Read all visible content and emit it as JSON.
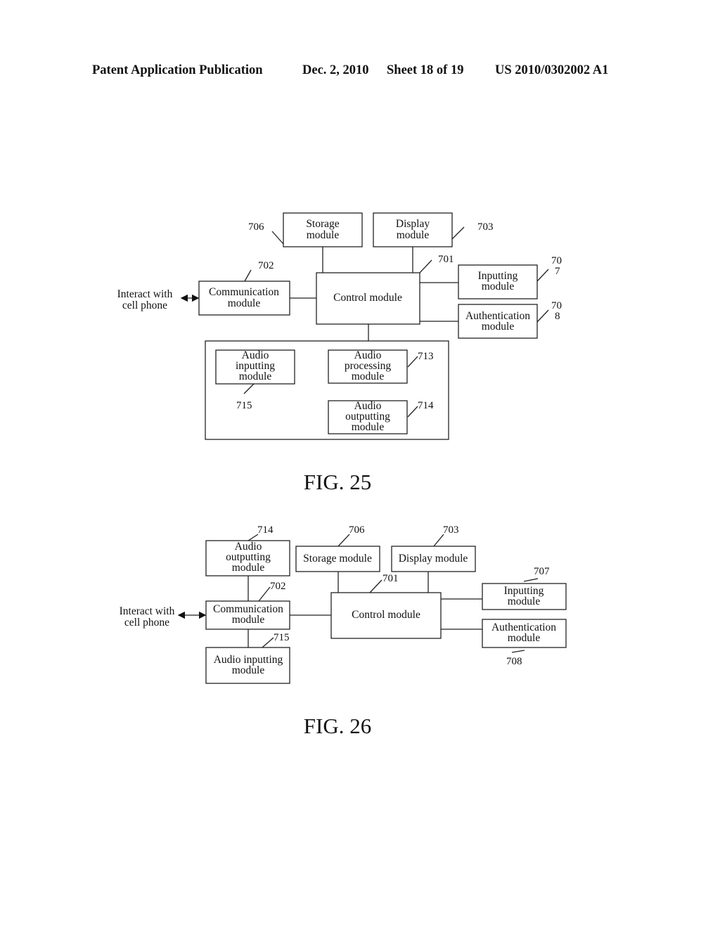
{
  "header": {
    "publication": "Patent Application Publication",
    "date": "Dec. 2, 2010",
    "sheet": "Sheet 18 of 19",
    "number": "US 2010/0302002 A1"
  },
  "fig25": {
    "caption": "FIG. 25",
    "external": [
      "Interact with",
      "cell phone"
    ],
    "storage": [
      "Storage",
      "module"
    ],
    "display": [
      "Display",
      "module"
    ],
    "communication": [
      "Communication",
      "module"
    ],
    "control": [
      "Control module"
    ],
    "inputting": [
      "Inputting",
      "module"
    ],
    "authentication": [
      "Authentication",
      "module"
    ],
    "audio_input": [
      "Audio",
      "inputting",
      "module"
    ],
    "audio_processing": [
      "Audio",
      "processing",
      "module"
    ],
    "audio_output": [
      "Audio",
      "outputting",
      "module"
    ],
    "refs": {
      "storage": "706",
      "display": "703",
      "communication": "702",
      "control": "701",
      "inputting_a": "70",
      "inputting_b": "7",
      "authentication_a": "70",
      "authentication_b": "8",
      "audio_processing": "713",
      "audio_output": "714",
      "audio_input": "715"
    }
  },
  "fig26": {
    "caption": "FIG. 26",
    "external": [
      "Interact with",
      "cell phone"
    ],
    "audio_output": [
      "Audio",
      "outputting",
      "module"
    ],
    "communication": [
      "Communication",
      "module"
    ],
    "audio_input": [
      "Audio inputting",
      "module"
    ],
    "storage": [
      "Storage module"
    ],
    "display": [
      "Display module"
    ],
    "control": [
      "Control module"
    ],
    "inputting": [
      "Inputting",
      "module"
    ],
    "authentication": [
      "Authentication",
      "module"
    ],
    "refs": {
      "audio_output": "714",
      "communication": "702",
      "audio_input": "715",
      "storage": "706",
      "display": "703",
      "control": "701",
      "inputting": "707",
      "authentication": "708"
    }
  }
}
